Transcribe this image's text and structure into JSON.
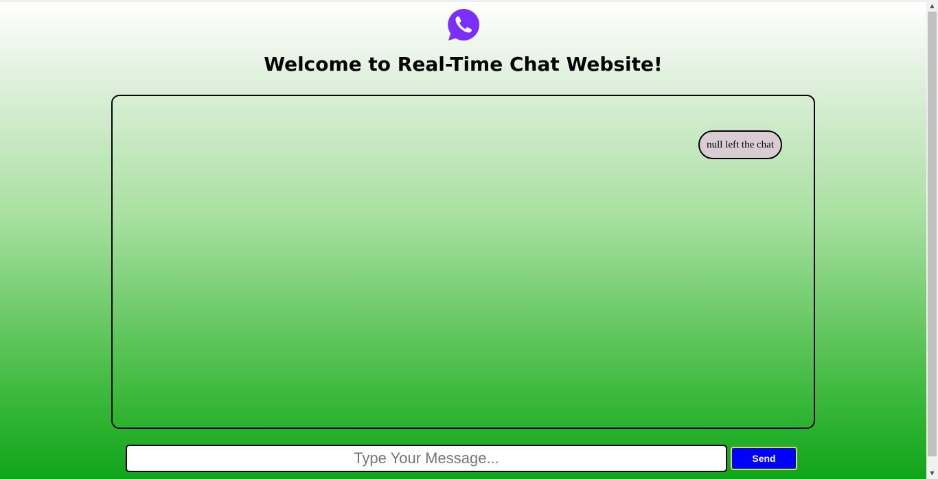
{
  "header": {
    "logo_icon": "whatsapp-icon",
    "logo_color": "#7b2fff",
    "title": "Welcome to Real-Time Chat Website!"
  },
  "chat": {
    "messages": [
      {
        "type": "system",
        "text": "null left the chat"
      }
    ]
  },
  "composer": {
    "input_value": "",
    "input_placeholder": "Type Your Message...",
    "send_label": "Send",
    "send_color": "#0000ff"
  }
}
